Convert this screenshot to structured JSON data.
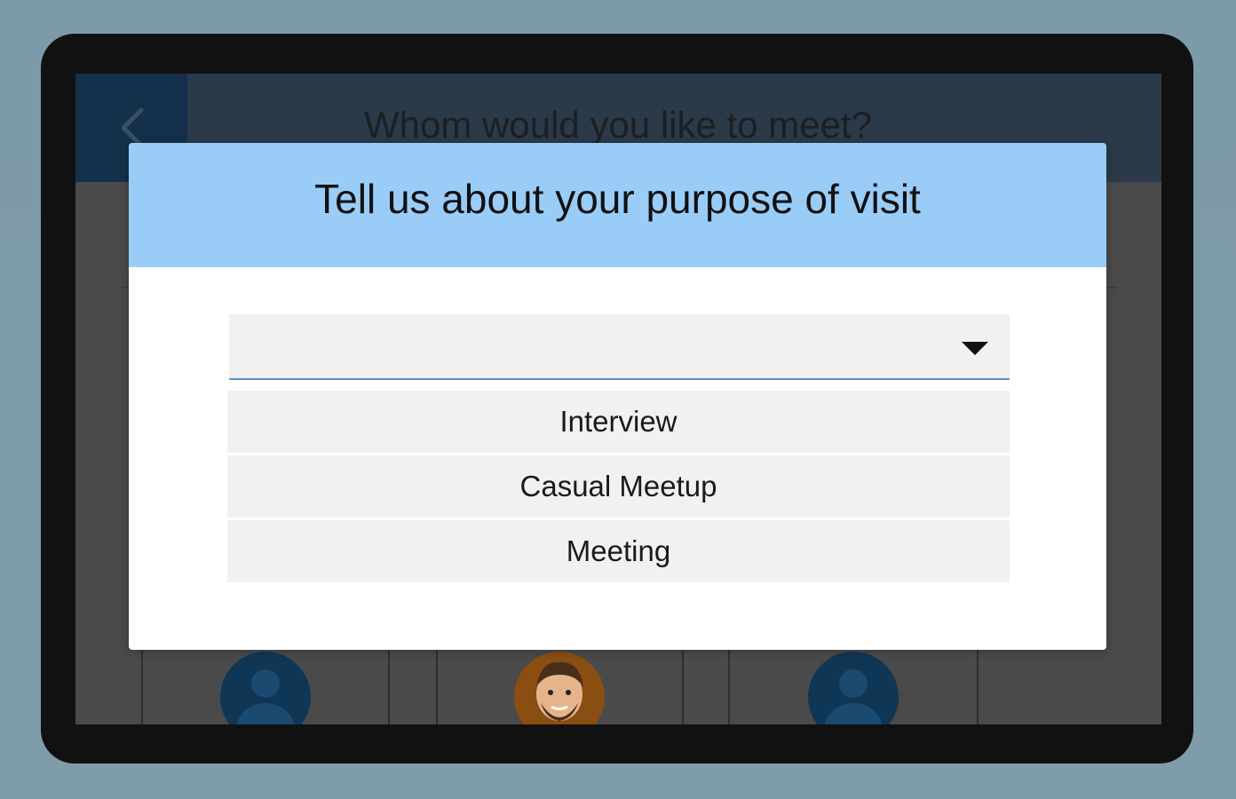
{
  "app": {
    "page_title": "Whom would you like to meet?"
  },
  "dialog": {
    "title": "Tell us about your purpose of visit",
    "select": {
      "value": ""
    },
    "options": [
      {
        "label": "Interview"
      },
      {
        "label": "Casual Meetup"
      },
      {
        "label": "Meeting"
      }
    ]
  },
  "icons": {
    "back": "chevron-left-icon",
    "dropdown": "caret-down-icon",
    "avatar_placeholder": "person-icon"
  },
  "colors": {
    "background": "#7e9ba8",
    "dialog_header": "#99cdf8",
    "select_underline": "#5b8fd6",
    "app_header": "#2b3a48",
    "back_button": "#14304a"
  }
}
